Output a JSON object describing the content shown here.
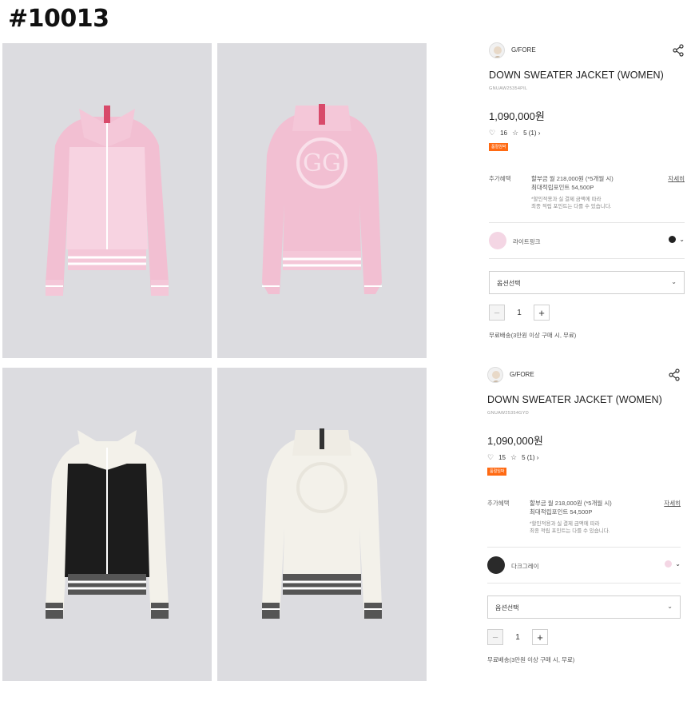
{
  "header": {
    "id": "#10013"
  },
  "photos": [
    {
      "alt": "pink jacket front",
      "color": "#f2bfd2"
    },
    {
      "alt": "pink jacket back",
      "color": "#f2bfd2"
    },
    {
      "alt": "dark jacket front",
      "color": "#1c1c1c"
    },
    {
      "alt": "white jacket back",
      "color": "#f3f1ea"
    }
  ],
  "products": [
    {
      "brand": "G/FORE",
      "title": "DOWN SWEATER JACKET (WOMEN)",
      "code": "GNUAW25354PIL",
      "price": "1,090,000원",
      "likes": "16",
      "rating": "5 (1) ›",
      "badge": "품절임박",
      "benefit_label": "추가혜택",
      "benefit_line1": "할부금 월 218,000원 (*5개월 시)",
      "benefit_line2": "최대적립포인트 54,500P",
      "benefit_note1": "*할인적용과 실 결제 금액에 따라",
      "benefit_note2": "최종 적립 포인트는 다를 수 있습니다.",
      "detail_link": "자세히",
      "color_name": "라이트핑크",
      "color_hex": "#f4d6e4",
      "alt_color_hex": "#222222",
      "option_placeholder": "옵션선택",
      "quantity": "1",
      "shipping": "무료배송(3만원 이상 구매 시, 무료)"
    },
    {
      "brand": "G/FORE",
      "title": "DOWN SWEATER JACKET (WOMEN)",
      "code": "GNUAW25354GYD",
      "price": "1,090,000원",
      "likes": "15",
      "rating": "5 (1) ›",
      "badge": "품절임박",
      "benefit_label": "추가혜택",
      "benefit_line1": "할부금 월 218,000원 (*5개월 시)",
      "benefit_line2": "최대적립포인트 54,500P",
      "benefit_note1": "*할인적용과 실 결제 금액에 따라",
      "benefit_note2": "최종 적립 포인트는 다를 수 있습니다.",
      "detail_link": "자세히",
      "color_name": "다크그레이",
      "color_hex": "#2a2a2a",
      "alt_color_hex": "#f4d6e4",
      "option_placeholder": "옵션선택",
      "quantity": "1",
      "shipping": "무료배송(3만원 이상 구매 시, 무료)"
    }
  ]
}
